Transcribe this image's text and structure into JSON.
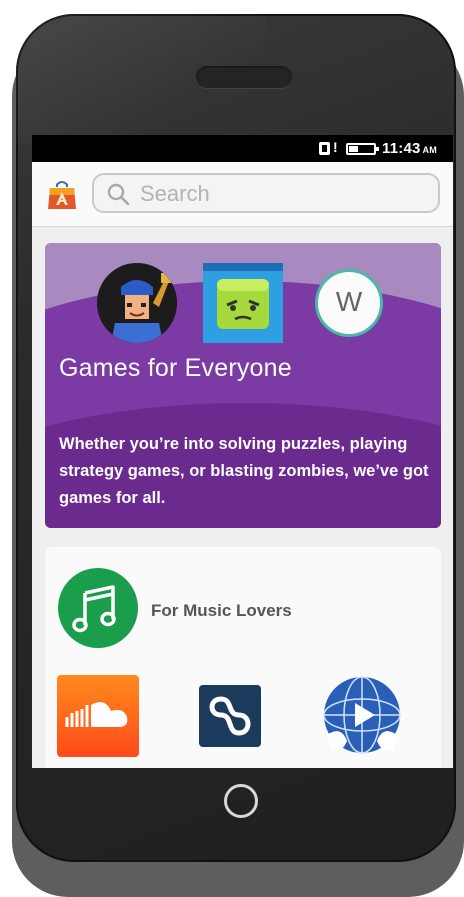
{
  "status_bar": {
    "time": "11:43",
    "ampm": "AM"
  },
  "search": {
    "placeholder": "Search"
  },
  "promo": {
    "title": "Games for Everyone",
    "description": "Whether you’re into solving puzzles, playing strategy games, or blasting zombies, we’ve got games for all.",
    "featured_apps": [
      "wreck-it-ralph-icon",
      "jelly-game-icon",
      "w-app-icon"
    ],
    "w_label": "W",
    "colors": {
      "light": "#a889c0",
      "mid": "#7b3aa4",
      "dark": "#6a2a8e"
    }
  },
  "music_section": {
    "label": "For Music Lovers",
    "apps": [
      "soundcloud-icon",
      "eight-tracks-icon",
      "globe-music-icon"
    ],
    "accent": "#1a9e4b"
  }
}
